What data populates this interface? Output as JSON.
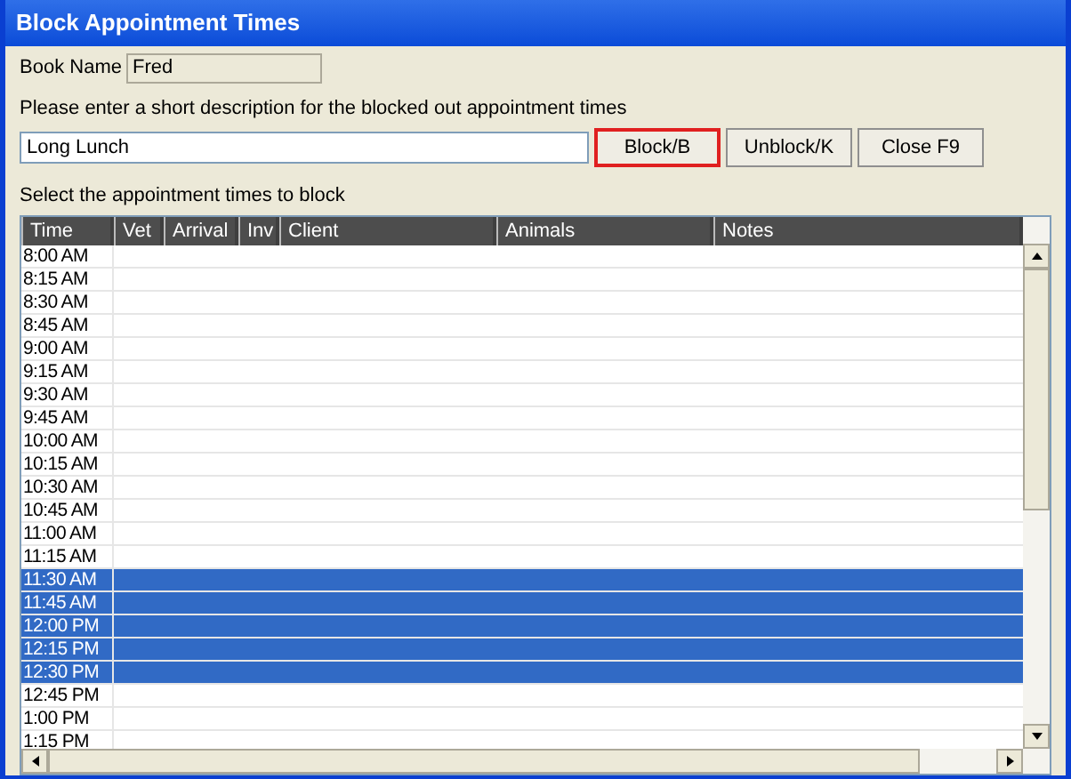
{
  "window": {
    "title": "Block Appointment Times"
  },
  "book_name": {
    "label": "Book Name",
    "value": "Fred"
  },
  "description": {
    "label": "Please enter a short description for the blocked out appointment times",
    "value": "Long Lunch"
  },
  "buttons": [
    {
      "label": "Block/B",
      "focused": true
    },
    {
      "label": "Unblock/K",
      "focused": false
    },
    {
      "label": "Close F9",
      "focused": false
    }
  ],
  "grid_label": "Select the appointment times to block",
  "table": {
    "columns": [
      "Time",
      "Vet",
      "Arrival",
      "Inv",
      "Client",
      "Animals",
      "Notes"
    ],
    "rows": [
      {
        "time": "8:00 AM",
        "selected": false
      },
      {
        "time": "8:15 AM",
        "selected": false
      },
      {
        "time": "8:30 AM",
        "selected": false
      },
      {
        "time": "8:45 AM",
        "selected": false
      },
      {
        "time": "9:00 AM",
        "selected": false
      },
      {
        "time": "9:15 AM",
        "selected": false
      },
      {
        "time": "9:30 AM",
        "selected": false
      },
      {
        "time": "9:45 AM",
        "selected": false
      },
      {
        "time": "10:00 AM",
        "selected": false
      },
      {
        "time": "10:15 AM",
        "selected": false
      },
      {
        "time": "10:30 AM",
        "selected": false
      },
      {
        "time": "10:45 AM",
        "selected": false
      },
      {
        "time": "11:00 AM",
        "selected": false
      },
      {
        "time": "11:15 AM",
        "selected": false
      },
      {
        "time": "11:30 AM",
        "selected": true
      },
      {
        "time": "11:45 AM",
        "selected": true
      },
      {
        "time": "12:00 PM",
        "selected": true
      },
      {
        "time": "12:15 PM",
        "selected": true
      },
      {
        "time": "12:30 PM",
        "selected": true
      },
      {
        "time": "12:45 PM",
        "selected": false
      },
      {
        "time": "1:00 PM",
        "selected": false
      },
      {
        "time": "1:15 PM",
        "selected": false
      }
    ]
  }
}
